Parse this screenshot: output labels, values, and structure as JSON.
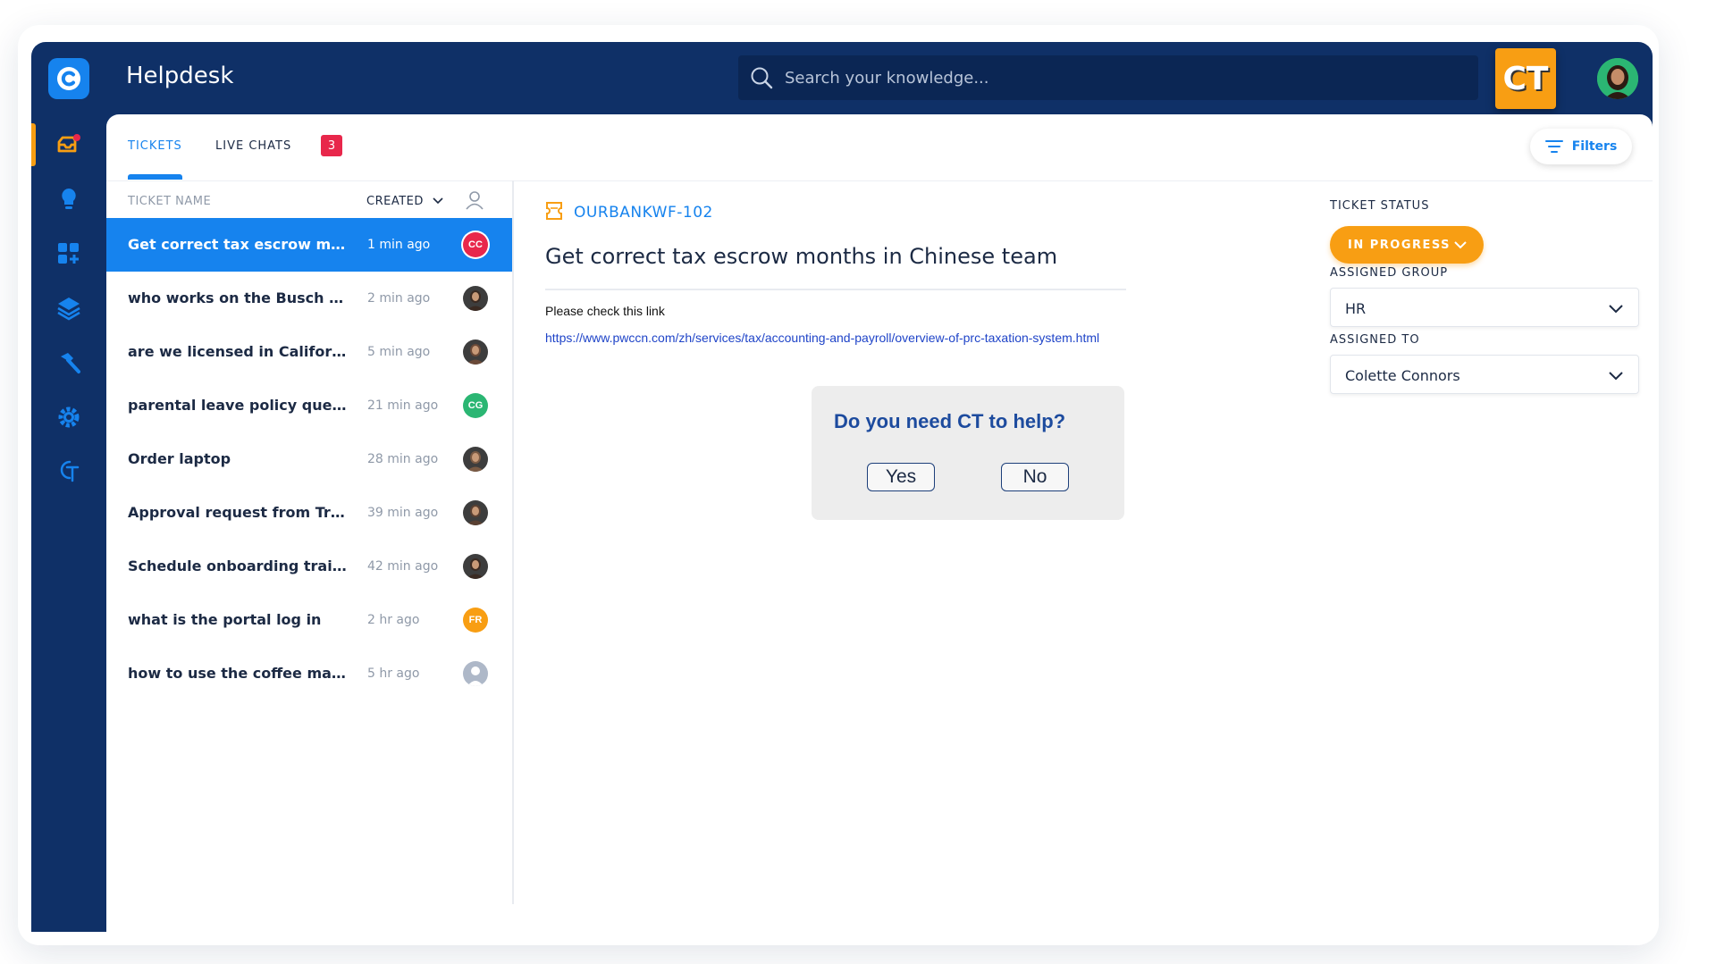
{
  "app": {
    "title": "Helpdesk",
    "logo_letter": "C"
  },
  "search": {
    "placeholder": "Search your knowledge..."
  },
  "ct_badge": {
    "label": "CT"
  },
  "sidebar": {
    "items": [
      {
        "icon": "inbox-icon",
        "active": true
      },
      {
        "icon": "lightbulb-icon"
      },
      {
        "icon": "apps-add-icon"
      },
      {
        "icon": "layers-icon"
      },
      {
        "icon": "hammer-icon"
      },
      {
        "icon": "gear-icon"
      },
      {
        "icon": "ct-logo-icon"
      }
    ]
  },
  "tabs": {
    "tickets": "TICKETS",
    "live_chats": "LIVE CHATS",
    "live_chats_count": "3"
  },
  "filters": {
    "label": "Filters"
  },
  "list_header": {
    "name": "TICKET NAME",
    "created": "CREATED"
  },
  "tickets": [
    {
      "title": "Get correct tax escrow months",
      "time": "1 min ago",
      "avatar": "CC",
      "avatar_color": "#e8274b"
    },
    {
      "title": "who works on the Busch project",
      "time": "2 min ago",
      "avatar": "photo"
    },
    {
      "title": "are we licensed in California?",
      "time": "5 min ago",
      "avatar": "photo"
    },
    {
      "title": "parental leave policy question",
      "time": "21 min ago",
      "avatar": "CG",
      "avatar_color": "#2bb673"
    },
    {
      "title": "Order laptop",
      "time": "28 min ago",
      "avatar": "photo"
    },
    {
      "title": "Approval request from Tracy",
      "time": "39 min ago",
      "avatar": "photo"
    },
    {
      "title": "Schedule onboarding training",
      "time": "42 min ago",
      "avatar": "photo"
    },
    {
      "title": "what is the portal log in",
      "time": "2 hr ago",
      "avatar": "FR",
      "avatar_color": "#f89e13"
    },
    {
      "title": "how to use the coffee maker",
      "time": "5 hr ago",
      "avatar": "placeholder"
    }
  ],
  "detail": {
    "ticket_id": "OURBANKWF-102",
    "title": "Get correct tax escrow months  in Chinese team",
    "note": "Please check this link",
    "link": "https://www.pwccn.com/zh/services/tax/accounting-and-payroll/overview-of-prc-taxation-system.html"
  },
  "help_prompt": {
    "question": "Do you need CT to help?",
    "yes": "Yes",
    "no": "No"
  },
  "right_panel": {
    "status_label": "TICKET STATUS",
    "status_value": "IN PROGRESS",
    "group_label": "ASSIGNED GROUP",
    "group_value": "HR",
    "assignee_label": "ASSIGNED TO",
    "assignee_value": "Colette Connors"
  },
  "colors": {
    "navy": "#0f3067",
    "blue": "#1683ee",
    "orange": "#f89e13",
    "red": "#e8274b",
    "green": "#2bb673"
  }
}
